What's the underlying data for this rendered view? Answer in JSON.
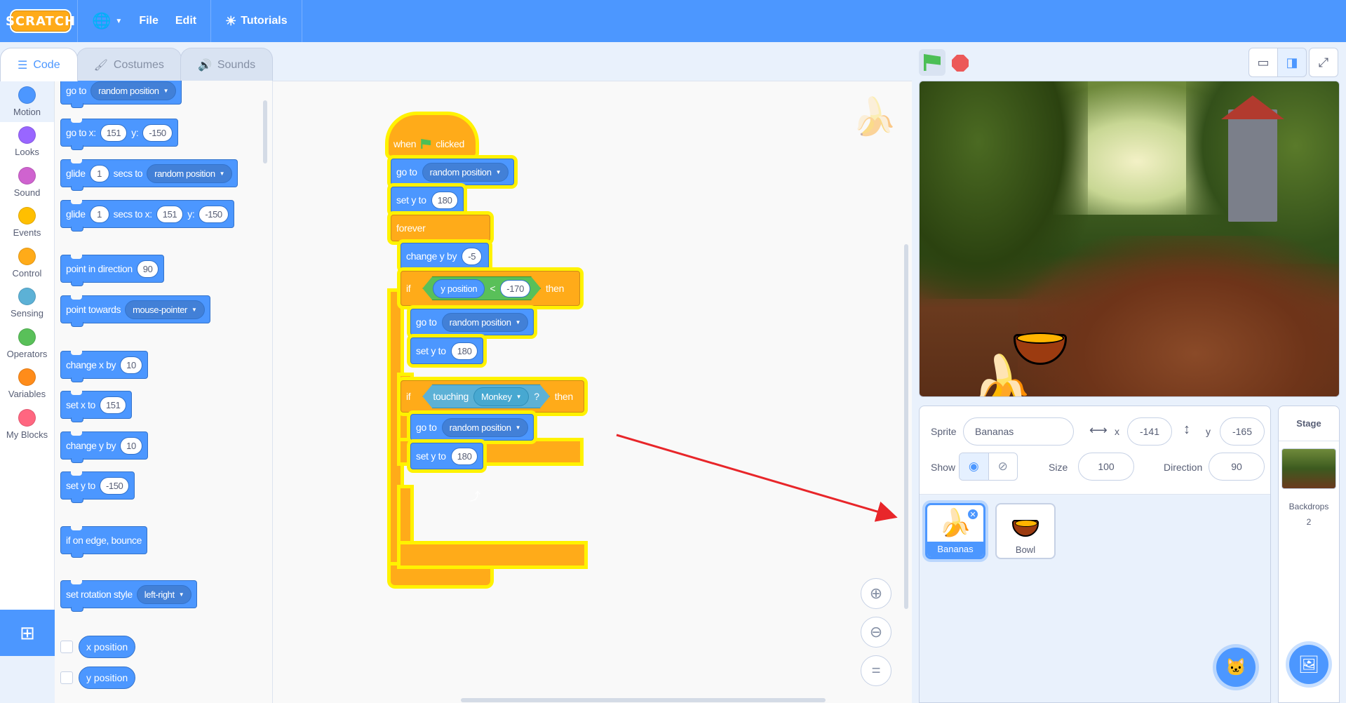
{
  "menubar": {
    "logo": "SCRATCH",
    "file": "File",
    "edit": "Edit",
    "tutorials": "Tutorials"
  },
  "tabs": [
    {
      "label": "Code",
      "icon": "code-icon"
    },
    {
      "label": "Costumes",
      "icon": "brush-icon"
    },
    {
      "label": "Sounds",
      "icon": "speaker-icon"
    }
  ],
  "categories": [
    {
      "label": "Motion",
      "color": "#4c97ff"
    },
    {
      "label": "Looks",
      "color": "#9966ff"
    },
    {
      "label": "Sound",
      "color": "#cf63cf"
    },
    {
      "label": "Events",
      "color": "#ffbf00"
    },
    {
      "label": "Control",
      "color": "#ffab19"
    },
    {
      "label": "Sensing",
      "color": "#5cb1d6"
    },
    {
      "label": "Operators",
      "color": "#59c059"
    },
    {
      "label": "Variables",
      "color": "#ff8c1a"
    },
    {
      "label": "My Blocks",
      "color": "#ff6680"
    }
  ],
  "palette": {
    "goto_random": {
      "t1": "go to",
      "dd": "random position"
    },
    "goto_xy": {
      "t1": "go to x:",
      "x": "151",
      "t2": "y:",
      "y": "-150"
    },
    "glide_random": {
      "t1": "glide",
      "n": "1",
      "t2": "secs to",
      "dd": "random position"
    },
    "glide_xy": {
      "t1": "glide",
      "n": "1",
      "t2": "secs to x:",
      "x": "151",
      "t3": "y:",
      "y": "-150"
    },
    "point_dir": {
      "t1": "point in direction",
      "n": "90"
    },
    "point_towards": {
      "t1": "point towards",
      "dd": "mouse-pointer"
    },
    "change_x": {
      "t1": "change x by",
      "n": "10"
    },
    "set_x": {
      "t1": "set x to",
      "n": "151"
    },
    "change_y": {
      "t1": "change y by",
      "n": "10"
    },
    "set_y": {
      "t1": "set y to",
      "n": "-150"
    },
    "bounce": {
      "t1": "if on edge, bounce"
    },
    "rotation": {
      "t1": "set rotation style",
      "dd": "left-right"
    },
    "x_position": "x position",
    "y_position": "y position"
  },
  "script": {
    "hat": {
      "t1": "when",
      "t2": "clicked"
    },
    "goto1": {
      "t1": "go to",
      "dd": "random position"
    },
    "sety1": {
      "t1": "set y to",
      "n": "180"
    },
    "forever": "forever",
    "changey": {
      "t1": "change y by",
      "n": "-5"
    },
    "if1": {
      "t1": "if",
      "rep": "y position",
      "op": "<",
      "n": "-170",
      "then": "then"
    },
    "goto2": {
      "t1": "go to",
      "dd": "random position"
    },
    "sety2": {
      "t1": "set y to",
      "n": "180"
    },
    "if2": {
      "t1": "if",
      "t2": "touching",
      "dd": "Monkey",
      "q": "?",
      "then": "then"
    },
    "goto3": {
      "t1": "go to",
      "dd": "random position"
    },
    "sety3": {
      "t1": "set y to",
      "n": "180"
    }
  },
  "stage_header": {
    "green_flag": "green-flag-icon",
    "stop": "stop-icon"
  },
  "sprite_info": {
    "sprite_label": "Sprite",
    "sprite_name": "Bananas",
    "x_label": "x",
    "x_value": "-141",
    "y_label": "y",
    "y_value": "-165",
    "show_label": "Show",
    "size_label": "Size",
    "size_value": "100",
    "direction_label": "Direction",
    "direction_value": "90"
  },
  "sprites": [
    {
      "name": "Bananas",
      "selected": true
    },
    {
      "name": "Bowl",
      "selected": false
    }
  ],
  "stage_panel": {
    "title": "Stage",
    "backdrops_label": "Backdrops",
    "backdrops_count": "2"
  },
  "colors": {
    "menubar": "#4c97ff",
    "motion": "#4c97ff",
    "control": "#ffab19",
    "glow": "#fff200",
    "annotation_arrow": "#e8262a"
  }
}
